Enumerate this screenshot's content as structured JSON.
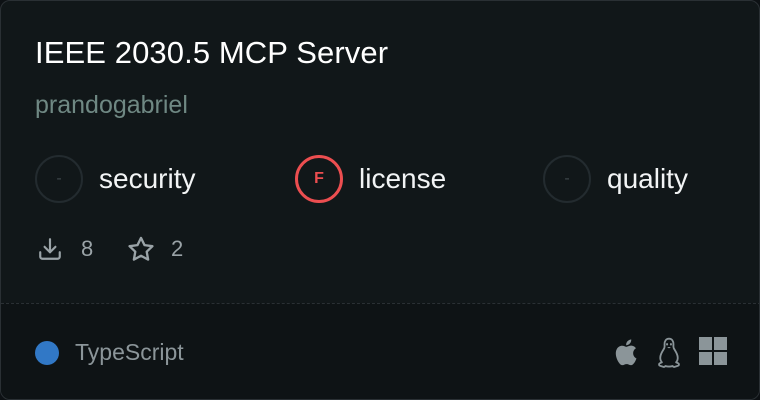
{
  "card": {
    "title": "IEEE 2030.5 MCP Server",
    "author": "prandogabriel"
  },
  "metrics": [
    {
      "grade": "-",
      "label": "security",
      "status": "none"
    },
    {
      "grade": "F",
      "label": "license",
      "status": "fail"
    },
    {
      "grade": "-",
      "label": "quality",
      "status": "none"
    }
  ],
  "stats": {
    "downloads": "8",
    "stars": "2",
    "download_icon": "download-icon",
    "star_icon": "star-icon"
  },
  "footer": {
    "language": "TypeScript",
    "language_color": "#3178c6",
    "platforms": [
      "apple-icon",
      "linux-icon",
      "windows-icon"
    ]
  },
  "colors": {
    "fail": "#ec4e50",
    "author": "#6f8883",
    "background": "#111719"
  }
}
